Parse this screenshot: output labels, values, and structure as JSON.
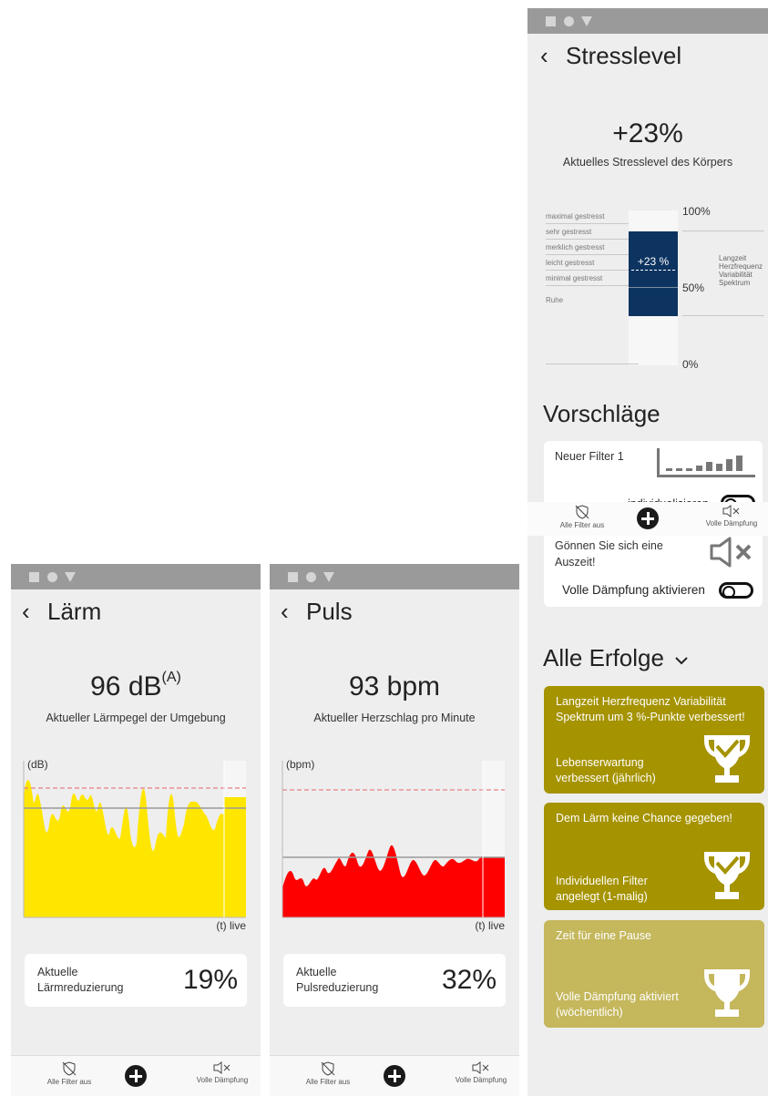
{
  "laerm": {
    "title": "Lärm",
    "value": "96 dB",
    "value_sup": "(A)",
    "subtitle": "Aktueller Lärmpegel der Umgebung",
    "y_unit": "(dB)",
    "x_label": "(t) live",
    "card_label": "Aktuelle Lärmreduzierung",
    "card_value": "19%",
    "chart_color": "#ffe600"
  },
  "puls": {
    "title": "Puls",
    "value": "93 bpm",
    "subtitle": "Aktueller Herzschlag pro Minute",
    "y_unit": "(bpm)",
    "x_label": "(t) live",
    "card_label": "Aktuelle Pulsreduzierung",
    "card_value": "32%",
    "chart_color": "#ff0000"
  },
  "stress": {
    "title": "Stresslevel",
    "value": "+23%",
    "subtitle": "Aktuelles Stresslevel des Körpers",
    "levels": [
      "maximal gestresst",
      "sehr gestresst",
      "merklich gestresst",
      "leicht gestresst",
      "minimal gestresst",
      "Ruhe"
    ],
    "bar_label": "+23 %",
    "pct_100": "100%",
    "pct_50": "50%",
    "pct_0": "0%",
    "side_label_lines": [
      "Langzeit",
      "Herzfrequenz",
      "Variabilität",
      "Spektrum"
    ],
    "bar_color": "#0d3461",
    "vorschlaege_heading": "Vorschläge",
    "filter_name": "Neuer Filter 1",
    "filter_action": "individualisieren",
    "auszeit_text": "Gönnen Sie sich eine Auszeit!",
    "daempfung_label": "Volle Dämpfung aktivieren",
    "erfolge_heading": "Alle Erfolge",
    "achievements": [
      {
        "title": "Langzeit Herzfrequenz Variabilität Spektrum um 3 %-Punkte verbessert!",
        "detail": "Lebenserwartung verbessert (jährlich)",
        "color": "#a59300"
      },
      {
        "title": "Dem Lärm keine Chance gegeben!",
        "detail": "Individuellen Filter angelegt (1-malig)",
        "color": "#a59300"
      },
      {
        "title": "Zeit für eine Pause",
        "detail": "Volle Dämpfung aktiviert (wöchentlich)",
        "color": "#c4b75c"
      }
    ]
  },
  "navbar": {
    "left_label": "Alle Filter aus",
    "right_label": "Volle Dämpfung"
  }
}
